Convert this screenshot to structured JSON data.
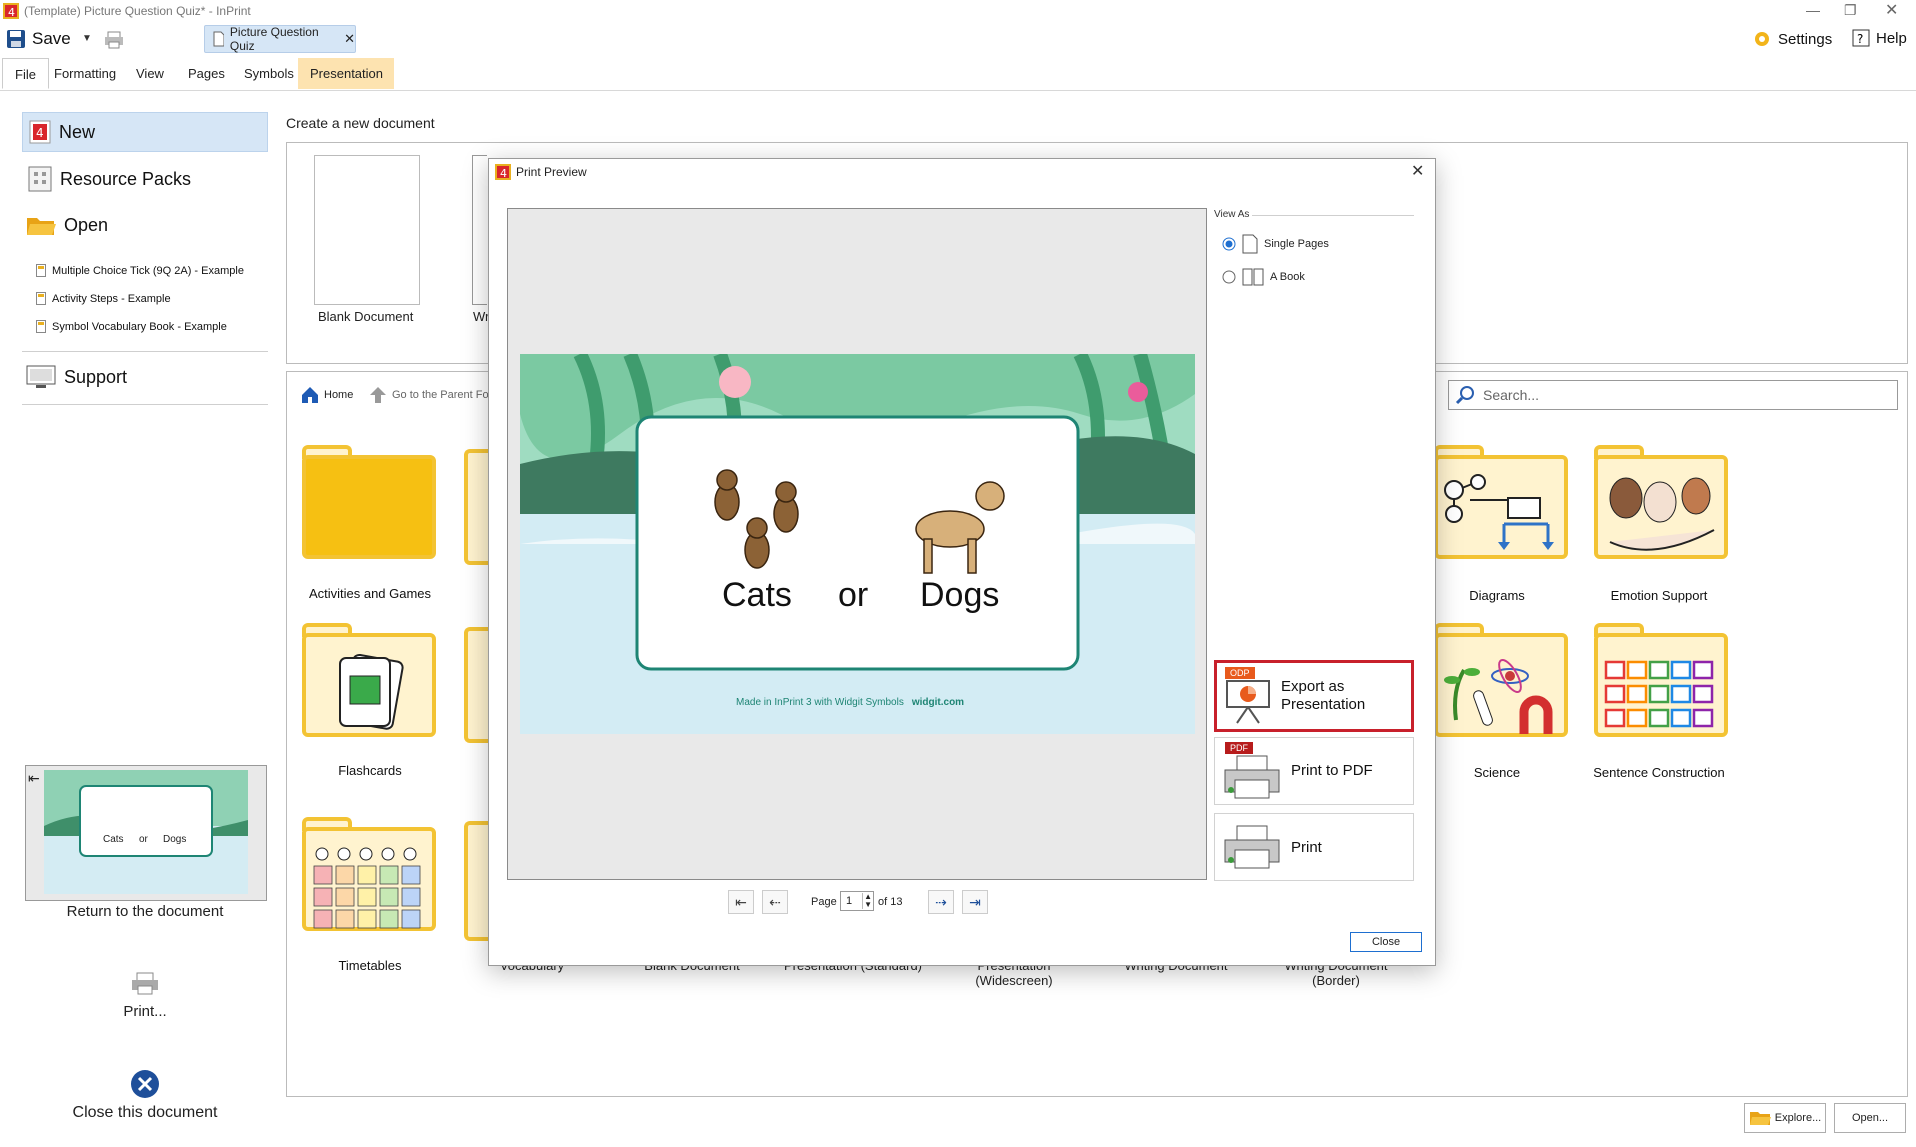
{
  "window": {
    "title": "(Template) Picture Question Quiz* - InPrint"
  },
  "toolbar": {
    "save_label": "Save",
    "document_tab": "Picture Question Quiz",
    "settings_label": "Settings",
    "help_label": "Help"
  },
  "ribbon": {
    "tabs": [
      "File",
      "Formatting",
      "View",
      "Pages",
      "Symbols",
      "Presentation"
    ]
  },
  "left_panel": {
    "new_label": "New",
    "resource_packs_label": "Resource Packs",
    "open_label": "Open",
    "recent": [
      "Multiple Choice Tick (9Q 2A) - Example",
      "Activity Steps - Example",
      "Symbol Vocabulary Book - Example"
    ],
    "support_label": "Support",
    "thumb_words": [
      "Cats",
      "or",
      "Dogs"
    ],
    "return_label": "Return to the document",
    "print_label": "Print...",
    "close_doc_label": "Close this document"
  },
  "content": {
    "create_heading": "Create a new document",
    "blank_document": "Blank Document",
    "partial_label": "Wr",
    "home_label": "Home",
    "parent_folder_label": "Go to the Parent Fo",
    "search_placeholder": "Search...",
    "folders": {
      "activities": "Activities and Games",
      "flashcards": "Flashcards",
      "timetables": "Timetables",
      "diagrams": "Diagrams",
      "emotion": "Emotion Support",
      "science": "Science",
      "sentence": "Sentence Construction"
    },
    "bottom_labels": [
      "Vocabulary",
      "Blank Document",
      "Presentation (Standard)",
      "Presentation (Widescreen)",
      "Writing Document",
      "Writing Document (Border)"
    ],
    "explore_label": "Explore...",
    "open_button_label": "Open..."
  },
  "dialog": {
    "title": "Print Preview",
    "view_as_label": "View As",
    "options": [
      "Single Pages",
      "A Book"
    ],
    "selected_option": "Single Pages",
    "slide_words": [
      "Cats",
      "or",
      "Dogs"
    ],
    "slide_footer": "Made in InPrint 3 with Widgit Symbols",
    "slide_footer_link": "widgit.com",
    "export_badge": "ODP",
    "export_label": "Export as Presentation",
    "pdf_badge": "PDF",
    "pdf_label": "Print to PDF",
    "print_label": "Print",
    "page_label": "Page",
    "page_value": "1",
    "page_of": "of 13",
    "close_button": "Close"
  },
  "colors": {
    "accent": "#d6e6f6",
    "folder_border": "#f3c333",
    "folder_fill": "#fff3cf",
    "export_highlight": "#c8202b",
    "slide_border": "#1e8574"
  }
}
